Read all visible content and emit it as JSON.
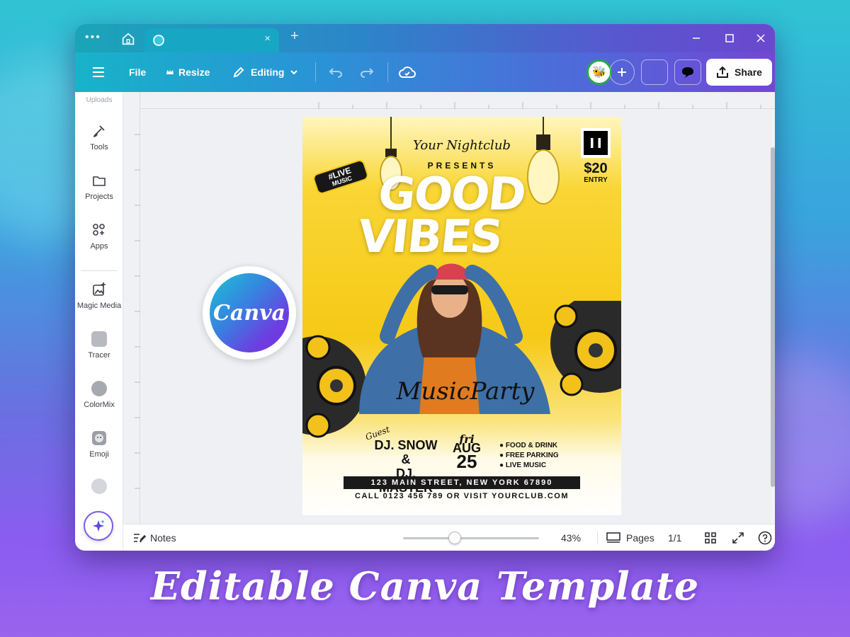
{
  "window": {
    "menu_dots": "•••",
    "tab_close": "×",
    "new_tab": "+"
  },
  "toolbar": {
    "file_label": "File",
    "resize_label": "Resize",
    "editing_label": "Editing",
    "share_label": "Share"
  },
  "sidebar": {
    "items": [
      {
        "label": "Uploads",
        "icon": "upload-icon"
      },
      {
        "label": "Tools",
        "icon": "tools-icon"
      },
      {
        "label": "Projects",
        "icon": "folder-icon"
      },
      {
        "label": "Apps",
        "icon": "apps-icon"
      },
      {
        "label": "Magic Media",
        "icon": "magic-media-icon"
      },
      {
        "label": "Tracer",
        "icon": "tracer-app-thumbnail"
      },
      {
        "label": "ColorMix",
        "icon": "colormix-app-thumbnail"
      },
      {
        "label": "Emoji",
        "icon": "emoji-icon"
      }
    ]
  },
  "flyer": {
    "club_script": "Your Nightclub",
    "presents": "PRESENTS",
    "headline_line1": "GOOD",
    "headline_line2": "VIBES",
    "badge_line1": "#LIVE",
    "badge_line2": "MUSIC",
    "price": "$20",
    "price_note": "ENTRY",
    "event_script": "MusicParty",
    "guest_script": "Guest",
    "dj_line1": "DJ. SNOW &",
    "dj_line2": "DJ. MASTER",
    "day_script": "fri",
    "month": "AUG",
    "date": "25",
    "features": [
      "FOOD & DRINK",
      "FREE PARKING",
      "LIVE MUSIC"
    ],
    "address": "123 MAIN STREET, NEW YORK 67890",
    "contact": "CALL 0123 456 789 OR VISIT YOURCLUB.COM"
  },
  "canva_badge": "Canva",
  "statusbar": {
    "notes_label": "Notes",
    "zoom": "43%",
    "zoom_level": 0.43,
    "pages_label": "Pages",
    "page_count": "1/1"
  },
  "headline": "Editable Canva Template",
  "colors": {
    "accent_purple": "#7b5ce8",
    "flyer_yellow": "#f6c916",
    "toolbar_start": "#17b3c9",
    "toolbar_end": "#7446d6"
  }
}
